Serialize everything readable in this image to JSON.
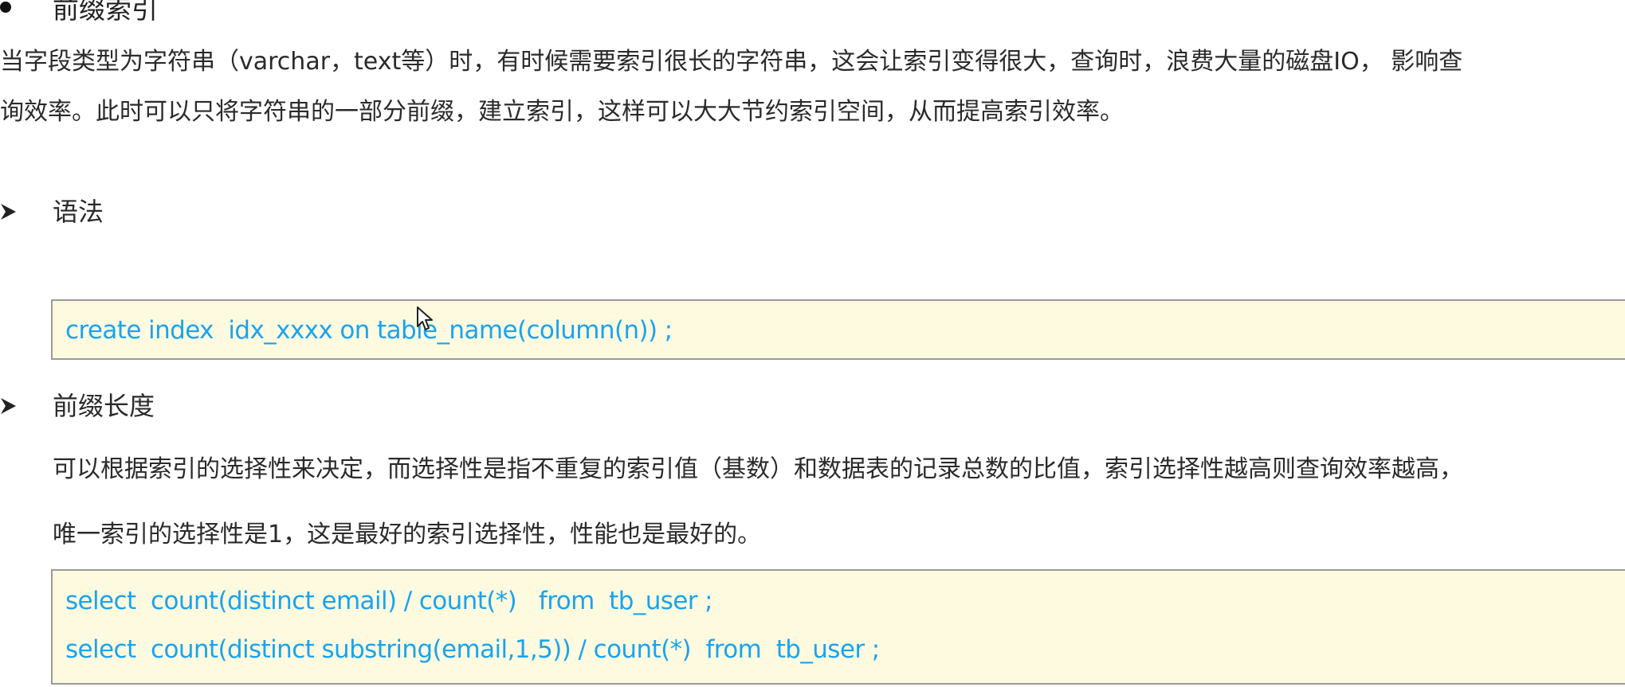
{
  "section": {
    "title": "前缀索引",
    "intro_line1": "当字段类型为字符串（varchar，text等）时，有时候需要索引很长的字符串，这会让索引变得很大，查询时，浪费大量的磁盘IO， 影响查",
    "intro_line2": "询效率。此时可以只将字符串的一部分前缀，建立索引，这样可以大大节约索引空间，从而提高索引效率。"
  },
  "syntax": {
    "heading": "语法",
    "code": "create index  idx_xxxx on table_name(column(n)) ;"
  },
  "prefix_length": {
    "heading": "前缀长度",
    "desc_line1": "可以根据索引的选择性来决定，而选择性是指不重复的索引值（基数）和数据表的记录总数的比值，索引选择性越高则查询效率越高，",
    "desc_line2": "唯一索引的选择性是1，这是最好的索引选择性，性能也是最好的。",
    "code_line1": "select  count(distinct email) / count(*)   from  tb_user ;",
    "code_line2": "select  count(distinct substring(email,1,5)) / count(*)  from  tb_user ;"
  },
  "colors": {
    "code_text": "#1aa3ee",
    "code_background": "#fefae0",
    "code_border": "#9a9a9a",
    "body_text": "#2a2a2a"
  },
  "icons": {
    "bullet": "filled-circle",
    "list_marker": "arrowhead",
    "pointer": "mouse-cursor-icon"
  }
}
